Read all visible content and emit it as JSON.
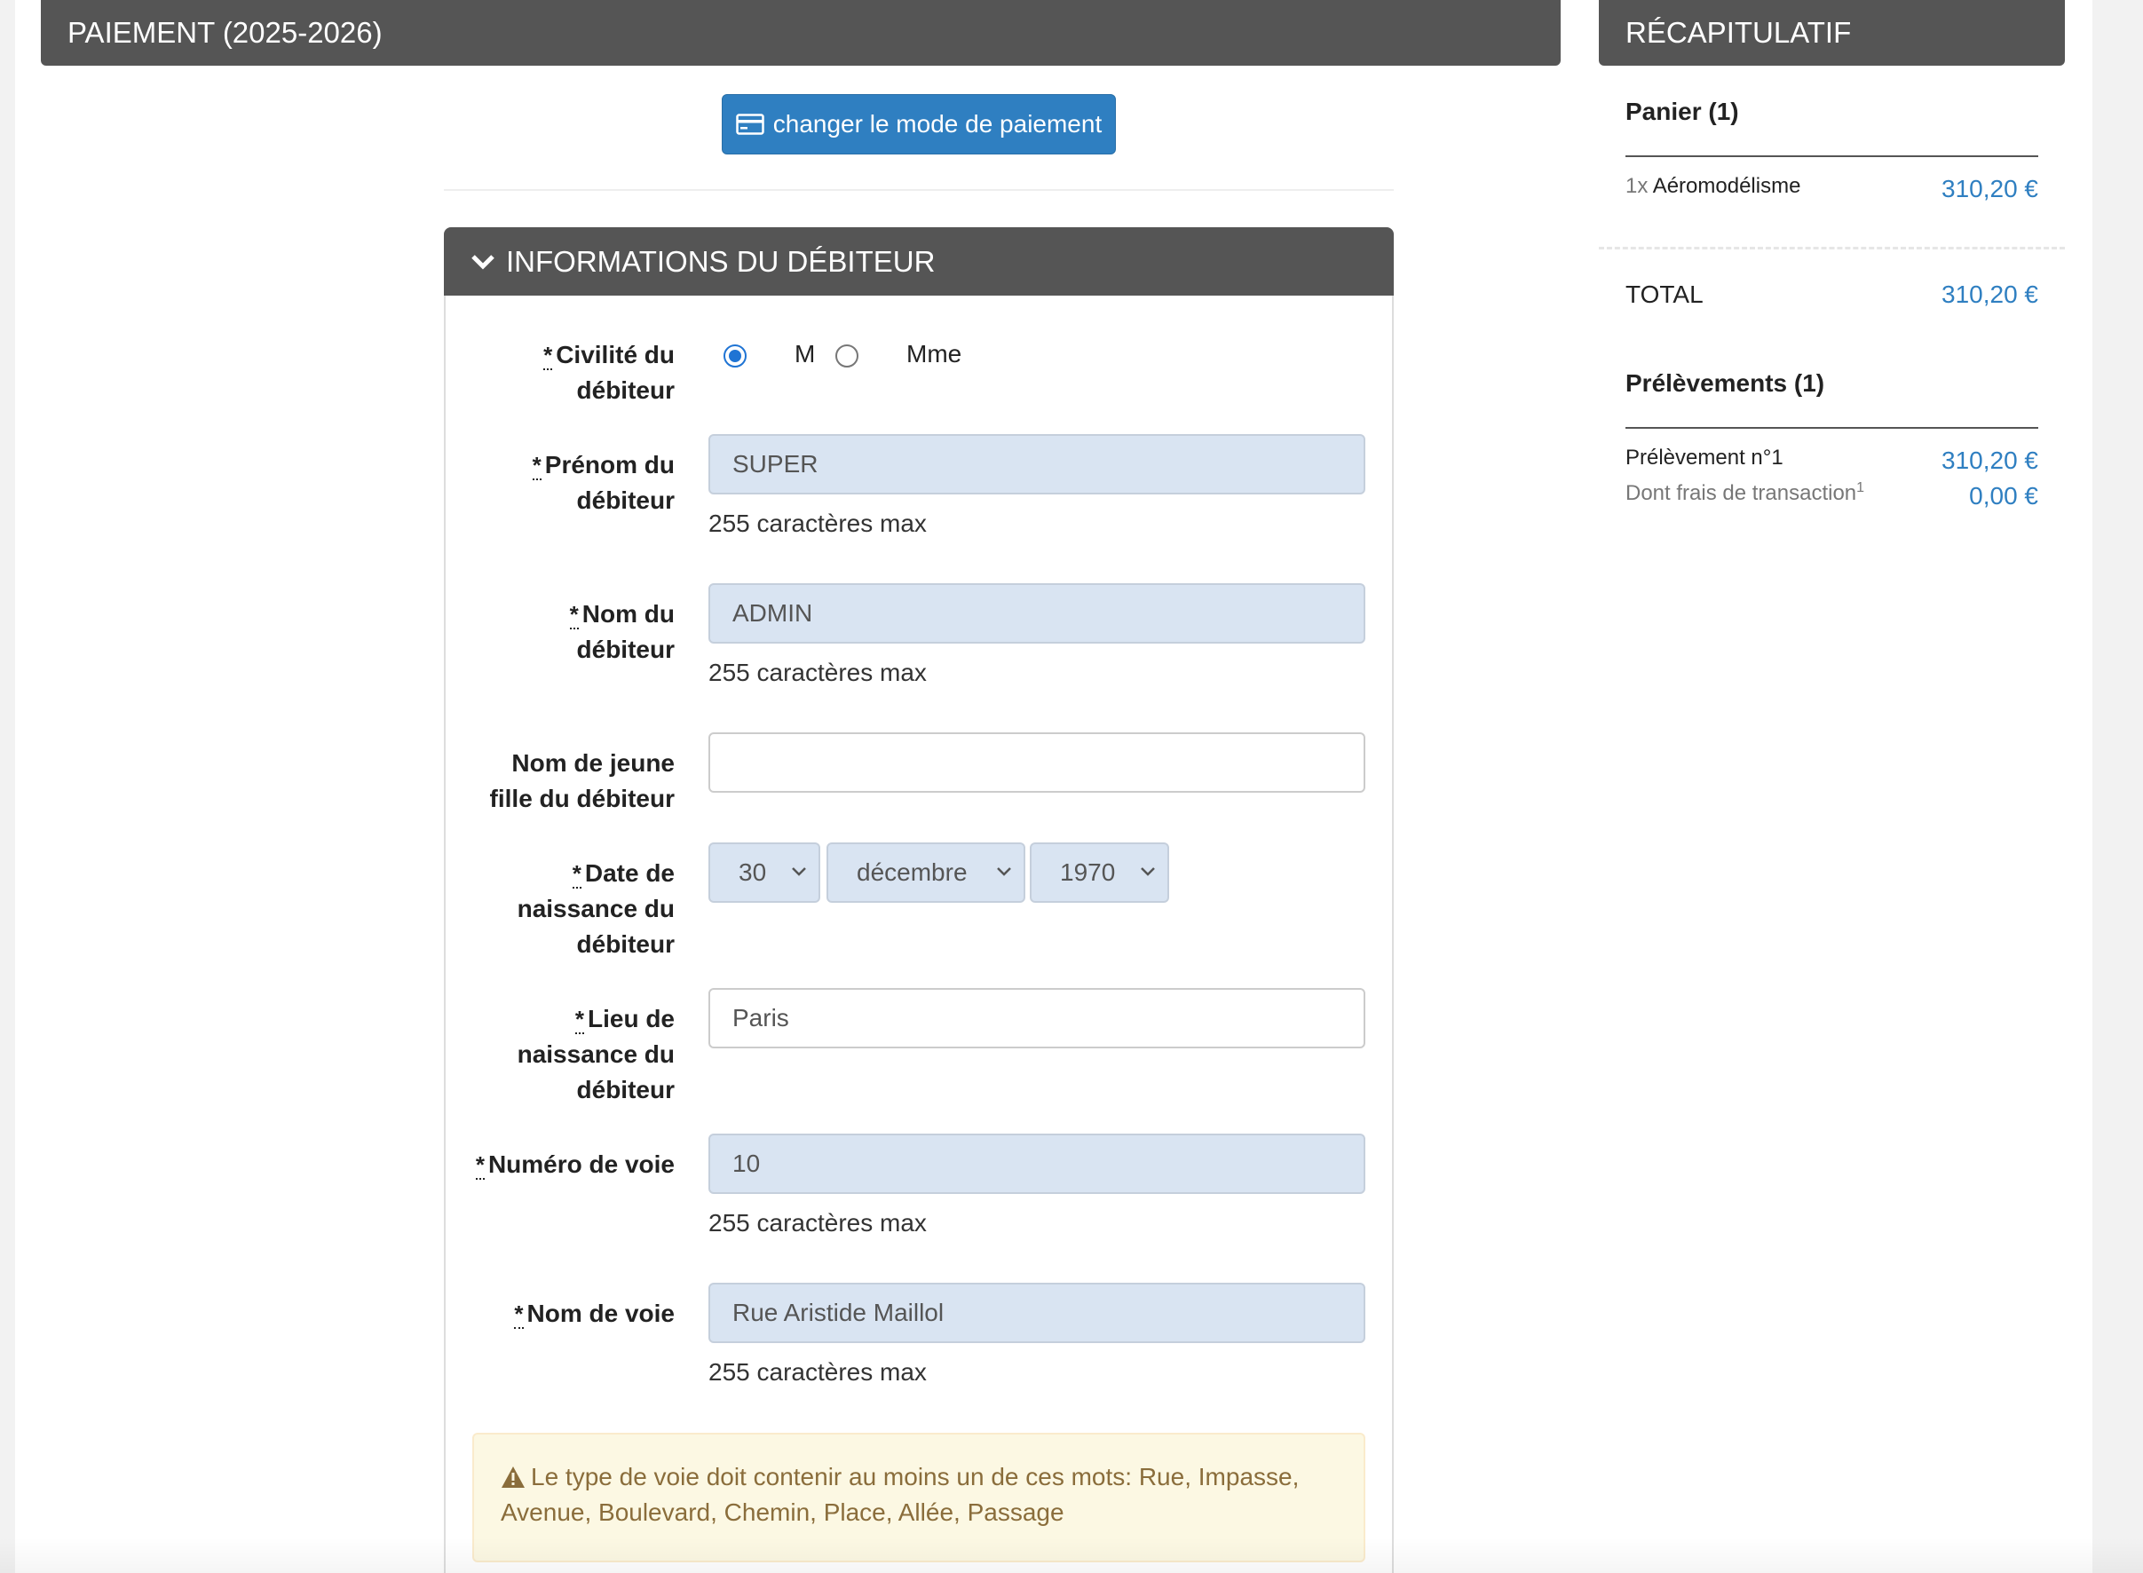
{
  "header": {
    "title": "PAIEMENT (2025-2026)"
  },
  "actions": {
    "change_payment": "changer le mode de paiement"
  },
  "debtor": {
    "section_title": "INFORMATIONS DU DÉBITEUR",
    "required_marker": "*",
    "help_text": "255 caractères max",
    "civility": {
      "label": "Civilité du débiteur",
      "options": [
        "M",
        "Mme"
      ],
      "selected": "M"
    },
    "first_name": {
      "label": "Prénom du débiteur",
      "value": "SUPER"
    },
    "last_name": {
      "label": "Nom du débiteur",
      "value": "ADMIN"
    },
    "maiden_name": {
      "label": "Nom de jeune fille du débiteur",
      "value": ""
    },
    "birth_date": {
      "label": "Date de naissance du débiteur",
      "day": "30",
      "month": "décembre",
      "year": "1970"
    },
    "birth_place": {
      "label": "Lieu de naissance du débiteur",
      "value": "Paris"
    },
    "street_number": {
      "label": "Numéro de voie",
      "value": "10"
    },
    "street_name": {
      "label": "Nom de voie",
      "value": "Rue Aristide Maillol"
    },
    "warning": "Le type de voie doit contenir au moins un de ces mots: Rue, Impasse, Avenue, Boulevard, Chemin, Place, Allée, Passage"
  },
  "recap": {
    "title": "RÉCAPITULATIF",
    "cart_title": "Panier (1)",
    "cart_item_qty": "1x",
    "cart_item_name": "Aéromodélisme",
    "cart_item_price": "310,20 €",
    "total_label": "TOTAL",
    "total_value": "310,20 €",
    "debits_title": "Prélèvements (1)",
    "debit_label": "Prélèvement n°1",
    "debit_value": "310,20 €",
    "fees_label": "Dont frais de transaction",
    "fees_sup": "1",
    "fees_value": "0,00 €"
  },
  "colors": {
    "primary": "#2f7fc1",
    "header_bg": "#555555",
    "filled_input": "#d9e4f2",
    "warning_bg": "#fcf8e3",
    "warning_text": "#8a6d3b"
  }
}
